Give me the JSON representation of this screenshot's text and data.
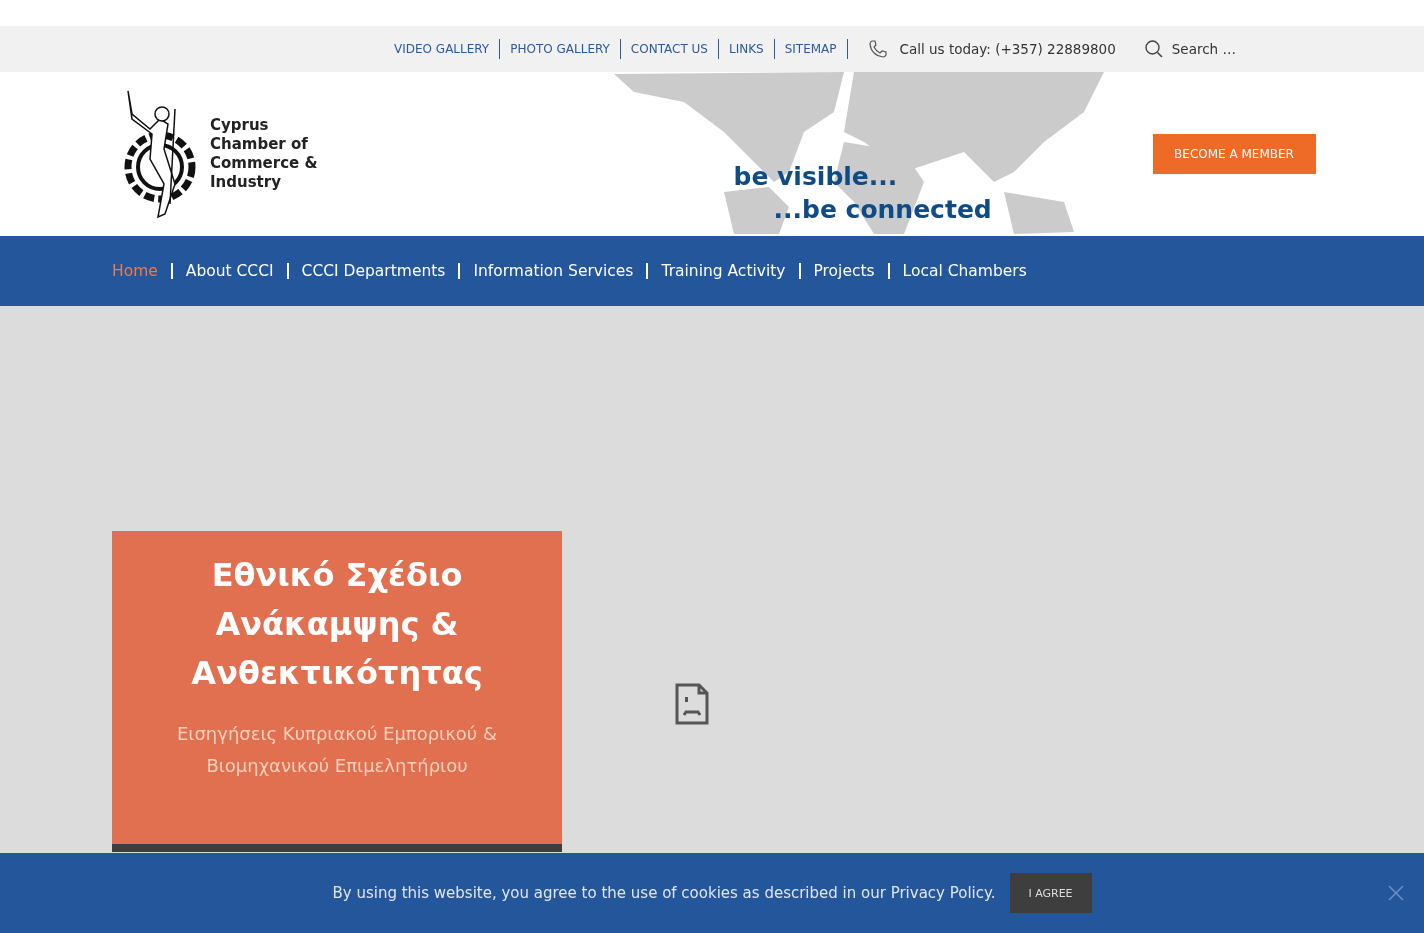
{
  "top_bar": {
    "links": [
      "VIDEO GALLERY",
      "PHOTO GALLERY",
      "CONTACT US",
      "LINKS",
      "SITEMAP"
    ],
    "phone": "Call us today: (+357) 22889800",
    "search": {
      "placeholder": "Search …"
    }
  },
  "header": {
    "logo_lines": [
      "Cyprus",
      "Chamber of",
      "Commerce &",
      "Industry"
    ],
    "tagline": [
      "be visible...",
      "...be connected"
    ],
    "cta": "BECOME A MEMBER"
  },
  "nav": [
    {
      "label": "Home",
      "selected": true
    },
    {
      "label": "About CCCI",
      "selected": false
    },
    {
      "label": "CCCI Departments",
      "selected": false
    },
    {
      "label": "Information Services",
      "selected": false
    },
    {
      "label": "Training Activity",
      "selected": false
    },
    {
      "label": "Projects",
      "selected": false
    },
    {
      "label": "Local Chambers",
      "selected": false
    }
  ],
  "feature": {
    "title": "Εθνικό Σχέδιο Ανάκαμψης & Ανθεκτικότητας",
    "subtitle": "Εισηγήσεις Κυπριακού Εμπορικού & Βιομηχανικού Επιμελητήριου"
  },
  "cookie_bar": {
    "message": "By using this website, you agree to the use of cookies as described in our Privacy Policy.",
    "button": "I AGREE"
  }
}
